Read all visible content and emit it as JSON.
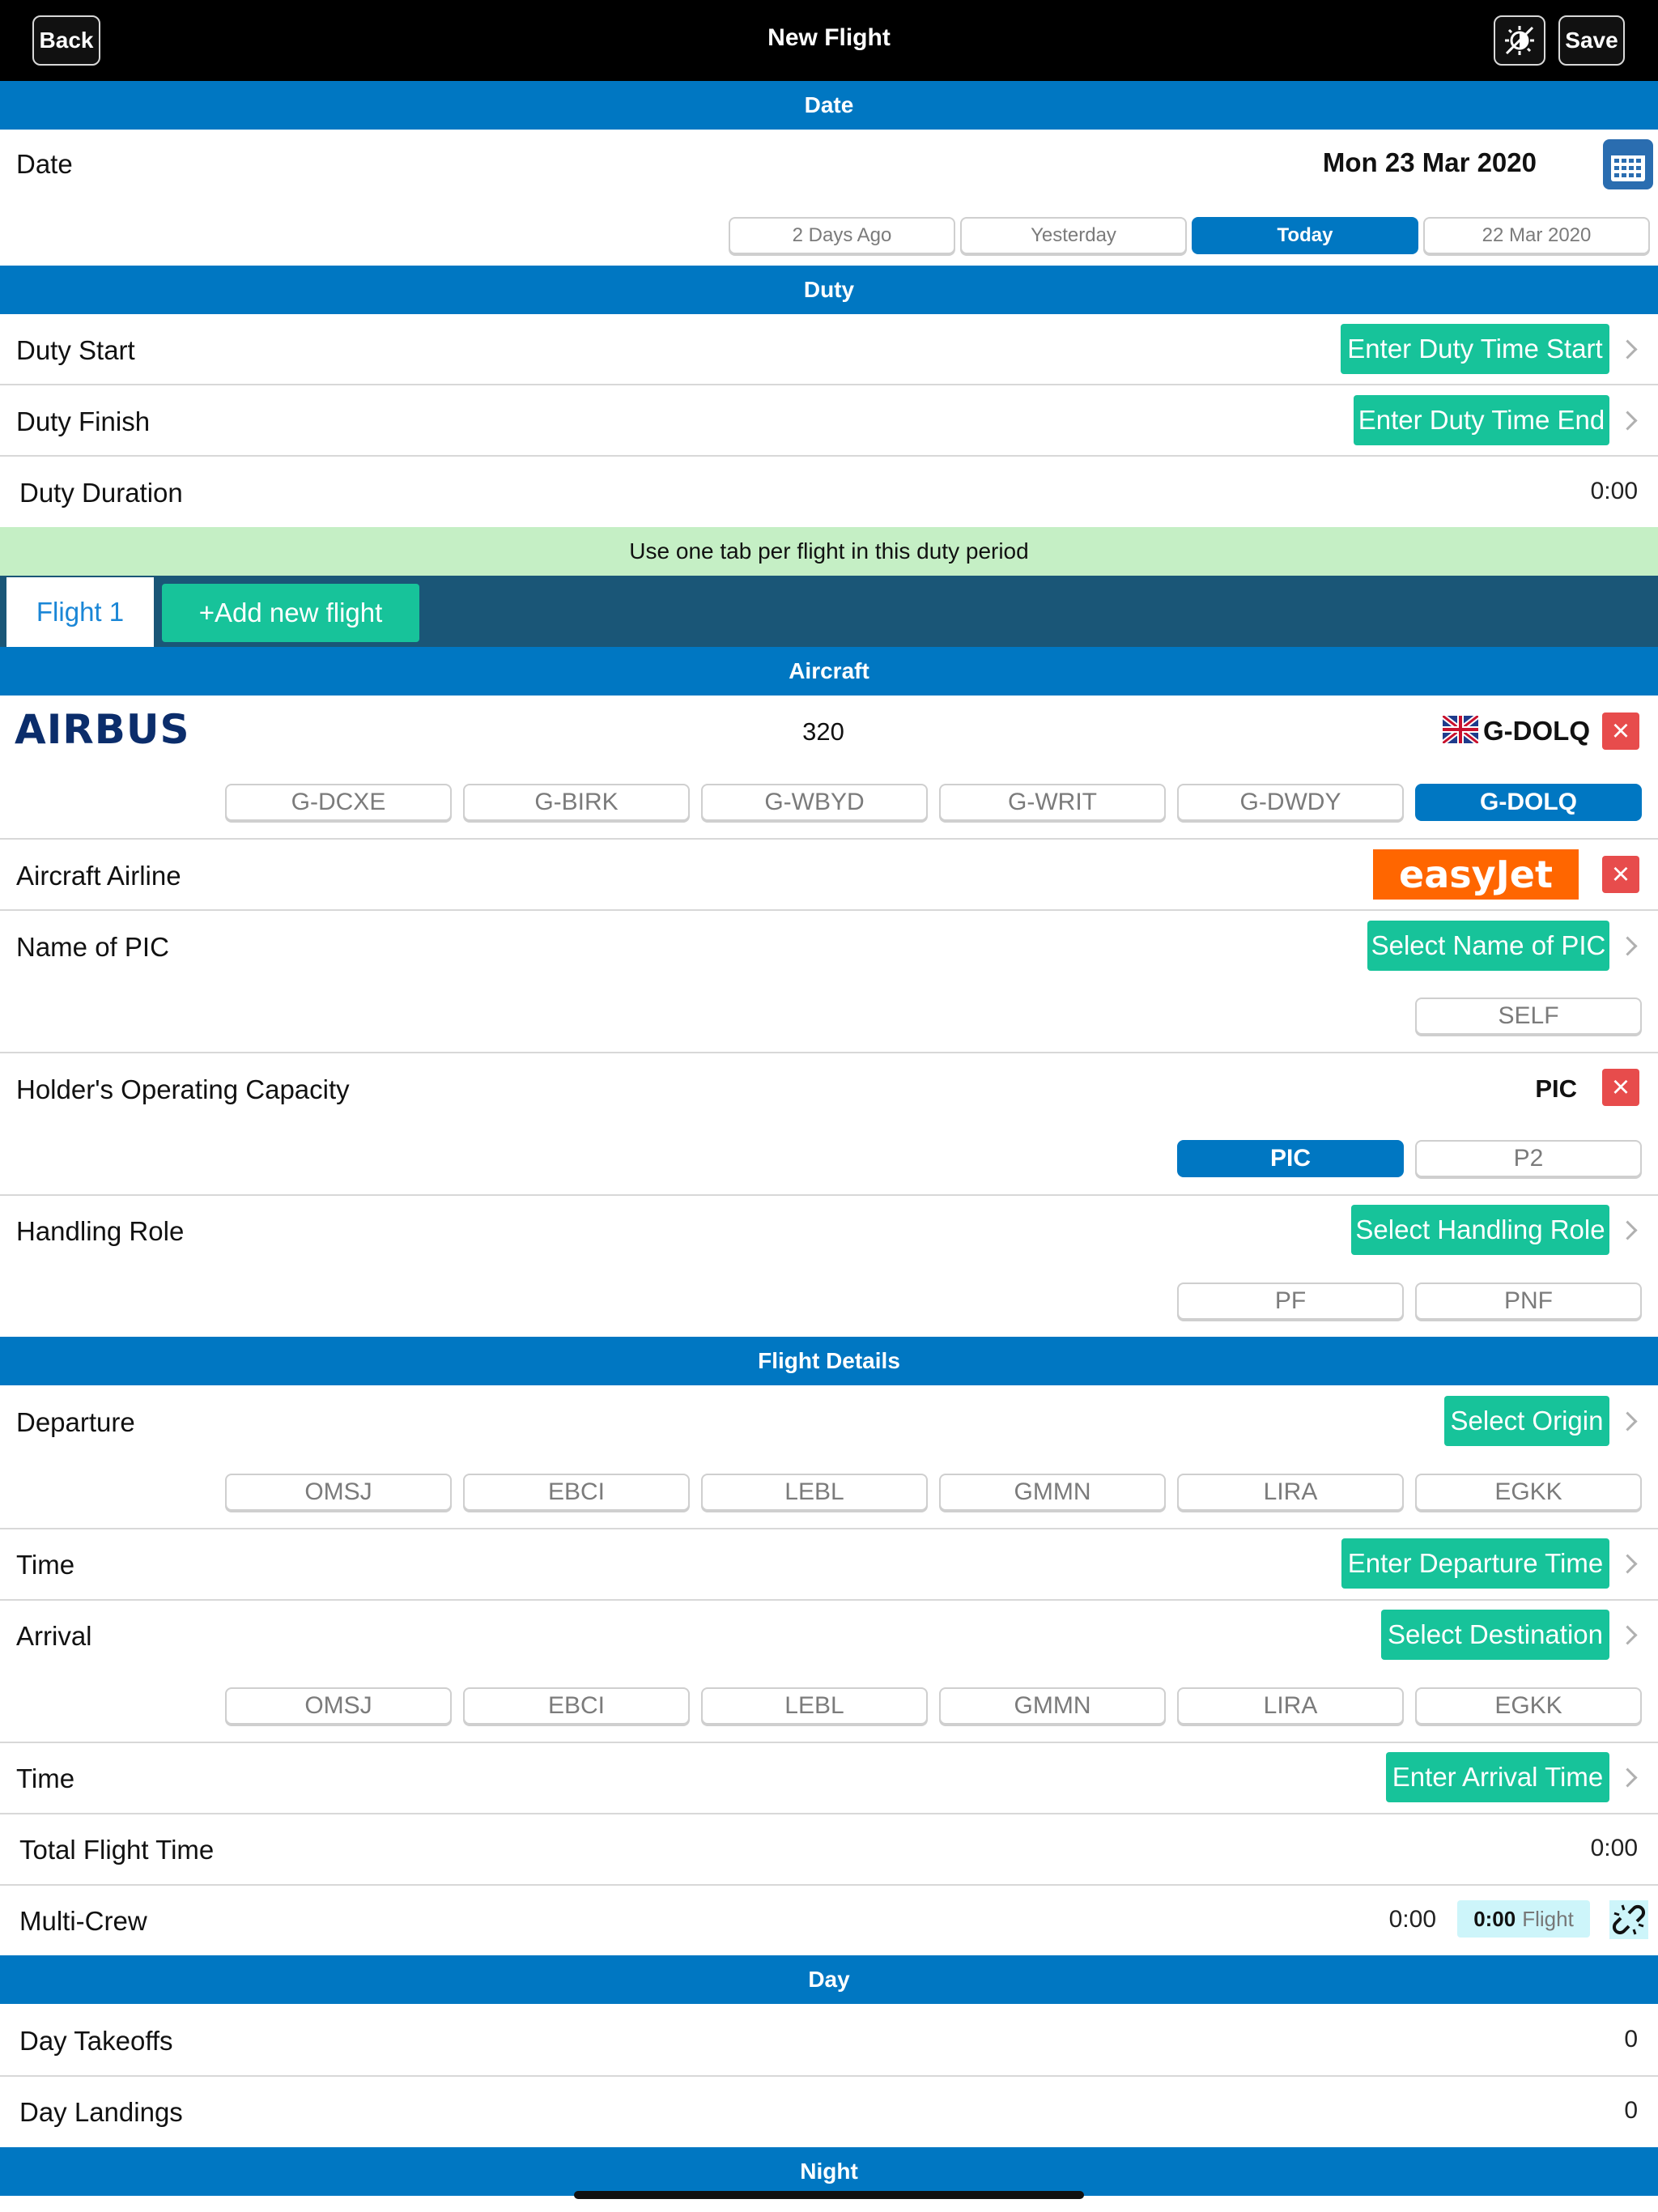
{
  "nav": {
    "back": "Back",
    "title": "New Flight",
    "save": "Save",
    "night_icon": "sun-moon-icon"
  },
  "date_section": {
    "header": "Date",
    "label": "Date",
    "value": "Mon 23 Mar 2020",
    "quick": [
      "2 Days Ago",
      "Yesterday",
      "Today",
      "22 Mar 2020"
    ],
    "selected": "Today"
  },
  "duty": {
    "header": "Duty",
    "start_label": "Duty Start",
    "start_btn": "Enter Duty Time Start",
    "finish_label": "Duty Finish",
    "finish_btn": "Enter Duty Time End",
    "duration_label": "Duty Duration",
    "duration_value": "0:00",
    "hint": "Use one tab per flight in this duty period"
  },
  "tabs": {
    "flight1": "Flight 1",
    "add": "+Add new flight"
  },
  "aircraft": {
    "header": "Aircraft",
    "maker": "AIRBUS",
    "model": "320",
    "registration": "G-DOLQ",
    "recent": [
      "G-DCXE",
      "G-BIRK",
      "G-WBYD",
      "G-WRIT",
      "G-DWDY",
      "G-DOLQ"
    ],
    "selected": "G-DOLQ",
    "airline_label": "Aircraft Airline",
    "airline_logo": "easyJet",
    "pic_label": "Name of PIC",
    "pic_btn": "Select Name of PIC",
    "pic_quick": "SELF",
    "capacity_label": "Holder's Operating Capacity",
    "capacity_value": "PIC",
    "capacity_options": [
      "PIC",
      "P2"
    ],
    "capacity_selected": "PIC",
    "role_label": "Handling Role",
    "role_btn": "Select Handling Role",
    "role_options": [
      "PF",
      "PNF"
    ]
  },
  "flight": {
    "header": "Flight Details",
    "dep_label": "Departure",
    "dep_btn": "Select Origin",
    "airports": [
      "OMSJ",
      "EBCI",
      "LEBL",
      "GMMN",
      "LIRA",
      "EGKK"
    ],
    "dep_time_label": "Time",
    "dep_time_btn": "Enter Departure Time",
    "arr_label": "Arrival",
    "arr_btn": "Select Destination",
    "arr_time_label": "Time",
    "arr_time_btn": "Enter Arrival Time",
    "total_label": "Total Flight Time",
    "total_value": "0:00",
    "mc_label": "Multi-Crew",
    "mc_value": "0:00",
    "mc_tag_value": "0:00",
    "mc_tag_label": "Flight"
  },
  "day": {
    "header": "Day",
    "takeoffs_label": "Day Takeoffs",
    "takeoffs_value": "0",
    "landings_label": "Day Landings",
    "landings_value": "0"
  },
  "night": {
    "header": "Night"
  },
  "colors": {
    "blue": "#0077c2",
    "green": "#17c39a",
    "red": "#e74c4c",
    "hint_bg": "#c5efc5",
    "tab_bar": "#1a5677"
  }
}
